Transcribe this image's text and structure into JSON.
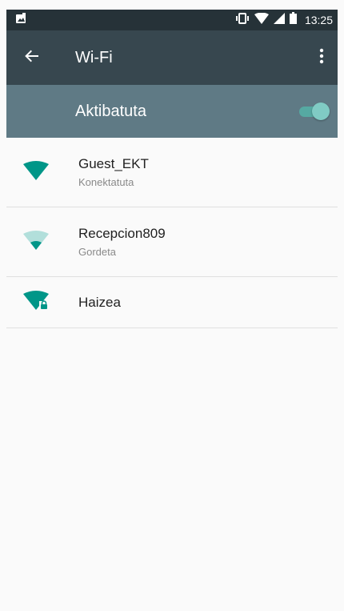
{
  "status_bar": {
    "time": "13:25",
    "icons": [
      "image-notification-icon",
      "vibrate-icon",
      "wifi-signal-icon",
      "cell-signal-icon",
      "battery-icon"
    ]
  },
  "toolbar": {
    "title": "Wi-Fi",
    "back_icon": "back-arrow-icon",
    "overflow_icon": "more-vert-icon"
  },
  "master_switch": {
    "label": "Aktibatuta",
    "on": true,
    "accent_color": "#80cbc4"
  },
  "networks": [
    {
      "name": "Guest_EKT",
      "status": "Konektatuta",
      "signal": "full",
      "locked": false
    },
    {
      "name": "Recepcion809",
      "status": "Gordeta",
      "signal": "weak",
      "locked": false
    },
    {
      "name": "Haizea",
      "status": "",
      "signal": "full",
      "locked": true
    }
  ],
  "colors": {
    "status_bar": "#263238",
    "toolbar": "#37474f",
    "switch_bar": "#5f7a85",
    "wifi_icon": "#009688",
    "wifi_icon_faded": "#b2dfdb"
  }
}
